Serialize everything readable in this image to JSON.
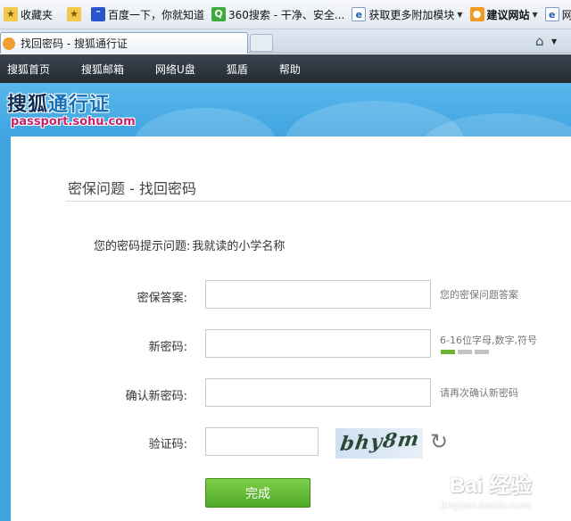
{
  "favorites": {
    "label": "收藏夹",
    "items": [
      {
        "label": "百度一下，你就知道"
      },
      {
        "label": "360搜索 - 干净、安全..."
      },
      {
        "label": "获取更多附加模块"
      },
      {
        "label": "建议网站"
      },
      {
        "label": "网"
      }
    ]
  },
  "tab": {
    "title": "找回密码 - 搜狐通行证"
  },
  "nav": {
    "items": [
      "搜狐首页",
      "搜狐邮箱",
      "网络U盘",
      "狐盾",
      "帮助"
    ]
  },
  "banner": {
    "logo_part1": "搜狐",
    "logo_part2": "通行证",
    "url": "passport.sohu.com"
  },
  "form": {
    "title": "密保问题 - 找回密码",
    "hint_label": "您的密码提示问题:",
    "hint_value": "我就读的小学名称",
    "answer_label": "密保答案:",
    "answer_value": "",
    "answer_tip": "您的密保问题答案",
    "new_password_label": "新密码:",
    "new_password_value": "",
    "new_password_tip": "6-16位字母,数字,符号",
    "strength_level": 1,
    "strength_max": 3,
    "confirm_label": "确认新密码:",
    "confirm_value": "",
    "confirm_tip": "请再次确认新密码",
    "captcha_label": "验证码:",
    "captcha_value": "",
    "captcha_image_text": "bhy8m",
    "submit_label": "完成"
  },
  "watermark": {
    "brand": "Bai 经验",
    "url": "jingyan.baidu.com"
  },
  "colors": {
    "nav_bg": "#2b333b",
    "banner_bg": "#4aacE6",
    "submit_green": "#5cb532",
    "strength_on": "#6cb22f"
  }
}
